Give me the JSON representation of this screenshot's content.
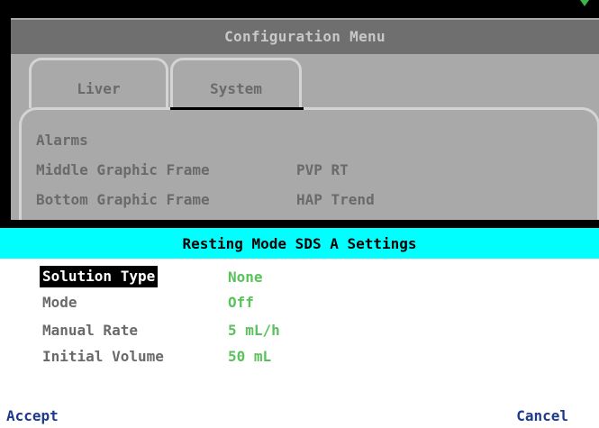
{
  "config_menu": {
    "title": "Configuration Menu",
    "tabs": [
      {
        "label": "Liver"
      },
      {
        "label": "System"
      }
    ],
    "rows": [
      {
        "label": "Alarms",
        "value": ""
      },
      {
        "label": "Middle Graphic Frame",
        "value": "PVP RT"
      },
      {
        "label": "Bottom Graphic Frame",
        "value": "HAP Trend"
      }
    ]
  },
  "settings_dialog": {
    "title": "Resting Mode SDS A Settings",
    "settings": [
      {
        "label": "Solution Type",
        "value": "None",
        "selected": true
      },
      {
        "label": "Mode",
        "value": "Off",
        "selected": false
      },
      {
        "label": "Manual Rate",
        "value": "5 mL/h",
        "selected": false
      },
      {
        "label": "Initial Volume",
        "value": "50 mL",
        "selected": false
      }
    ],
    "accept_label": "Accept",
    "cancel_label": "Cancel"
  },
  "colors": {
    "dialog_header": "#00ffff",
    "value_green": "#5ac25a",
    "button_blue": "#1f3a8a",
    "indicator_green": "#39b54a"
  },
  "icons": {
    "corner_indicator": "green-triangle-icon"
  }
}
